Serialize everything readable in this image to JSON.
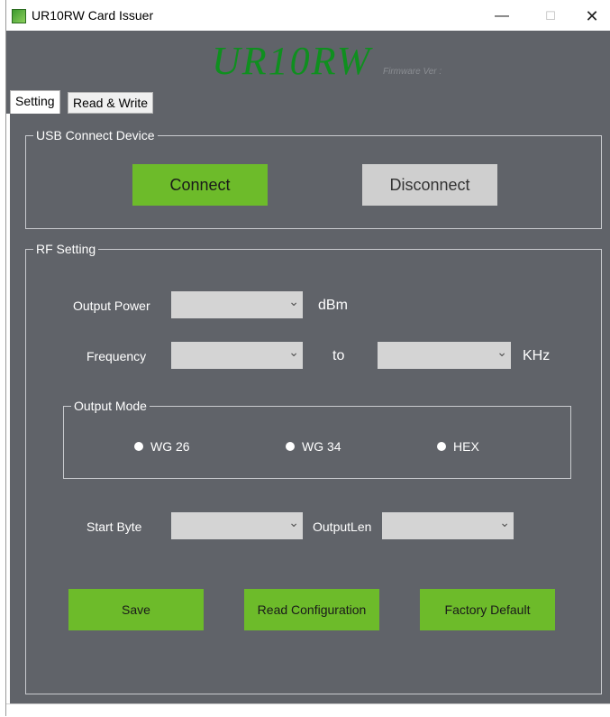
{
  "window": {
    "title": "UR10RW Card Issuer",
    "minimize_glyph": "—",
    "maximize_glyph": "☐",
    "close_glyph": "✕",
    "icon": "app-icon"
  },
  "banner": {
    "logo": "UR10RW",
    "firmware_label": "Firmware Ver :"
  },
  "tabs": [
    {
      "label": "Setting",
      "active": true
    },
    {
      "label": "Read & Write",
      "active": false
    }
  ],
  "usb": {
    "title": "USB Connect Device",
    "connect_label": "Connect",
    "disconnect_label": "Disconnect"
  },
  "rf": {
    "title": "RF Setting",
    "output_power_label": "Output Power",
    "output_power_value": "",
    "output_power_unit": "dBm",
    "frequency_label": "Frequency",
    "frequency_from_value": "",
    "frequency_to_label": "to",
    "frequency_to_value": "",
    "frequency_unit": "KHz",
    "output_mode": {
      "title": "Output Mode",
      "options": [
        "WG 26",
        "WG 34",
        "HEX"
      ]
    },
    "start_byte_label": "Start Byte",
    "start_byte_value": "",
    "output_len_label": "OutputLen",
    "output_len_value": ""
  },
  "actions": {
    "save_label": "Save",
    "read_config_label": "Read Configuration",
    "factory_default_label": "Factory Default"
  },
  "colors": {
    "accent_green": "#6dbb2a",
    "panel_bg": "#606369",
    "logo_green": "#0f8f1f"
  }
}
